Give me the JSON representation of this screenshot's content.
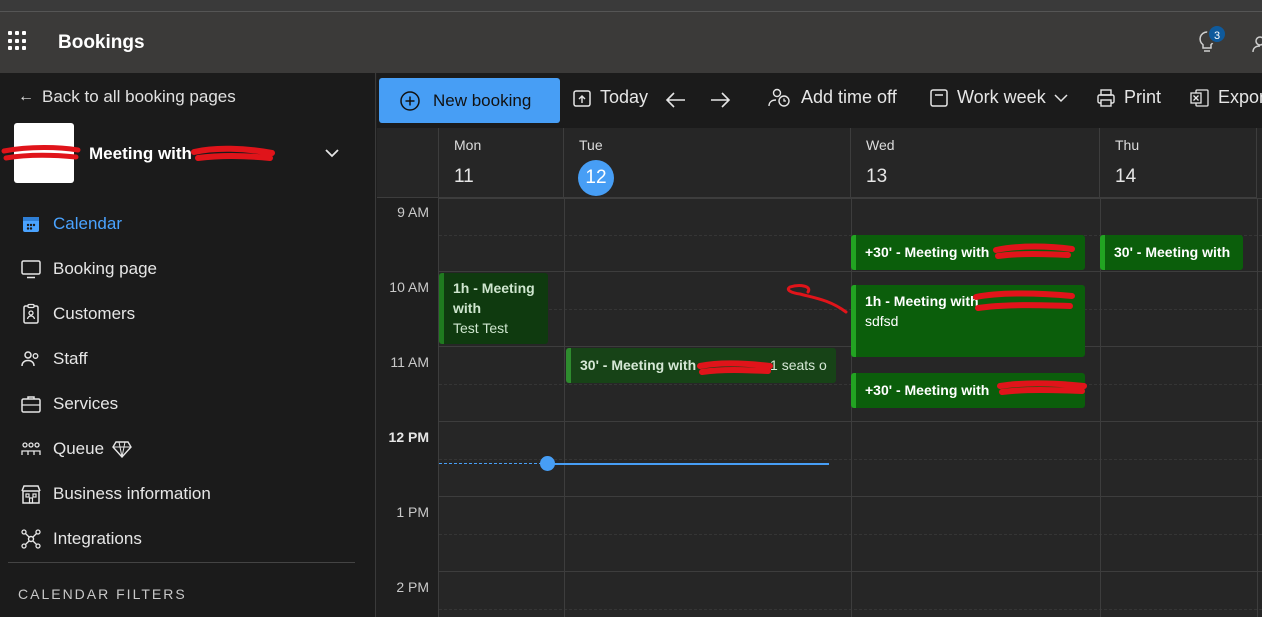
{
  "header": {
    "app_title": "Bookings",
    "notifications_count": "3"
  },
  "sidebar": {
    "back_label": "Back to all booking pages",
    "page_name": "Meeting with",
    "nav": [
      {
        "label": "Calendar",
        "icon": "calendar-icon",
        "active": true
      },
      {
        "label": "Booking page",
        "icon": "monitor-icon"
      },
      {
        "label": "Customers",
        "icon": "clipboard-icon"
      },
      {
        "label": "Staff",
        "icon": "people-icon"
      },
      {
        "label": "Services",
        "icon": "briefcase-icon"
      },
      {
        "label": "Queue",
        "icon": "queue-icon",
        "premium_icon": "diamond-icon"
      },
      {
        "label": "Business information",
        "icon": "building-icon"
      },
      {
        "label": "Integrations",
        "icon": "network-icon"
      }
    ],
    "filters_title": "CALENDAR FILTERS"
  },
  "toolbar": {
    "new_booking": "New booking",
    "today": "Today",
    "add_time_off": "Add time off",
    "view": "Work week",
    "print": "Print",
    "export": "Expor"
  },
  "calendar": {
    "days": [
      {
        "name": "Mon",
        "date": "11"
      },
      {
        "name": "Tue",
        "date": "12",
        "today": true
      },
      {
        "name": "Wed",
        "date": "13"
      },
      {
        "name": "Thu",
        "date": "14"
      }
    ],
    "times": [
      "9 AM",
      "10 AM",
      "11 AM",
      "12 PM",
      "1 PM",
      "2 PM"
    ],
    "events": {
      "mon_1": {
        "title": "1h - Meeting with",
        "subtitle": "Test Test"
      },
      "tue_1": {
        "title": "30' - Meeting with",
        "extra": "1 seats o"
      },
      "wed_1": {
        "title": "+30' - Meeting with"
      },
      "wed_2": {
        "title": "1h - Meeting with",
        "subtitle": "sdfsd"
      },
      "wed_3": {
        "title": "+30' - Meeting with"
      },
      "thu_1": {
        "title": "30' - Meeting with"
      }
    }
  },
  "colors": {
    "accent": "#479ef5",
    "event_green": "#0b5e0b",
    "annotation_red": "#e0141a"
  }
}
